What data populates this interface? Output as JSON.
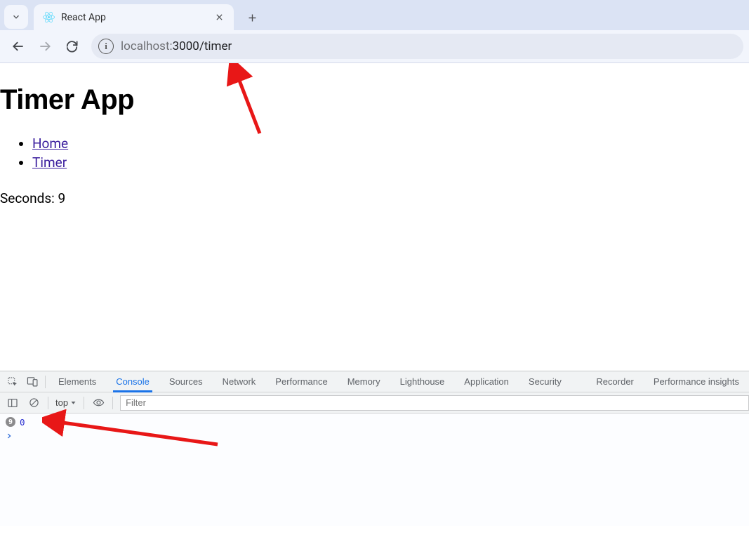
{
  "browser": {
    "tab_title": "React App",
    "url_host": "localhost:",
    "url_port": "3000",
    "url_path": "/timer"
  },
  "page": {
    "heading": "Timer App",
    "nav": {
      "home": "Home",
      "timer": "Timer"
    },
    "seconds_label": "Seconds: ",
    "seconds_value": "9"
  },
  "devtools": {
    "tabs": {
      "elements": "Elements",
      "console": "Console",
      "sources": "Sources",
      "network": "Network",
      "performance": "Performance",
      "memory": "Memory",
      "lighthouse": "Lighthouse",
      "application": "Application",
      "security": "Security",
      "recorder": "Recorder",
      "perf_insights": "Performance insights"
    },
    "context": "top",
    "filter_placeholder": "Filter",
    "log_count": "9",
    "log_value": "0"
  }
}
